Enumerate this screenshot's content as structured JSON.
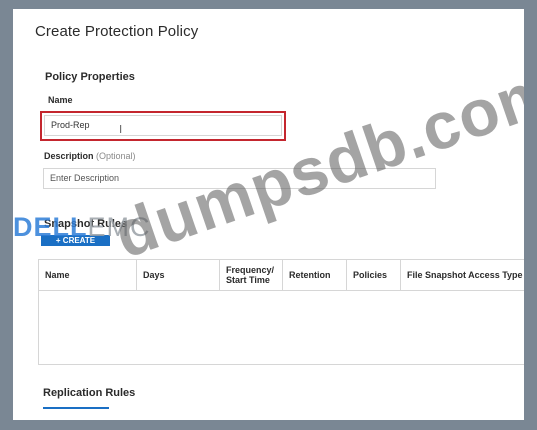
{
  "dialog": {
    "title": "Create Protection Policy"
  },
  "policy_properties": {
    "heading": "Policy Properties",
    "name_label": "Name",
    "name_value": "Prod-Rep",
    "description_label": "Description",
    "description_optional": "(Optional)",
    "description_placeholder": "Enter Description"
  },
  "snapshot_rules": {
    "heading": "Snapshot Rules",
    "create_label": "+ CREATE",
    "columns": [
      "Name",
      "Days",
      "Frequency/ Start Time",
      "Retention",
      "Policies",
      "File Snapshot Access Type"
    ]
  },
  "replication_rules": {
    "heading": "Replication Rules"
  },
  "watermark": {
    "logo_dell": "DELL",
    "logo_emc": "EMC",
    "site": "dumpsdb.com"
  },
  "colors": {
    "accent": "#1a6fc4",
    "highlight_border": "#c4262e",
    "background": "#7a8794"
  }
}
